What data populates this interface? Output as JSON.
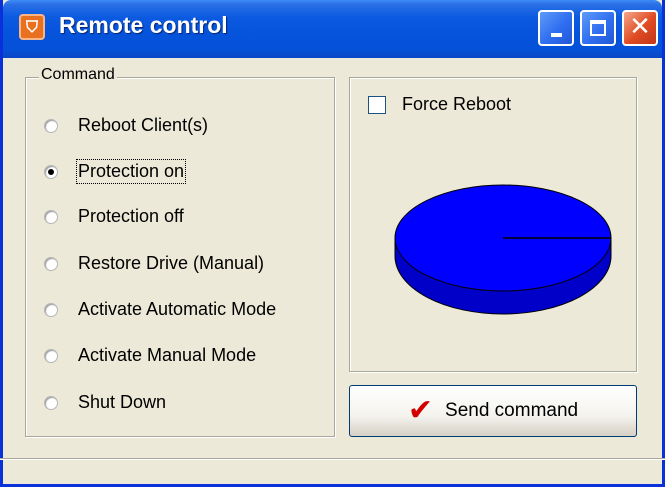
{
  "window": {
    "title": "Remote control",
    "app_icon": "shield-icon",
    "controls": {
      "minimize": "minimize-icon",
      "maximize": "maximize-icon",
      "close": "close-icon"
    }
  },
  "command_group": {
    "legend": "Command",
    "selected_index": 1,
    "options": [
      {
        "label": "Reboot Client(s)",
        "checked": false
      },
      {
        "label": "Protection on",
        "checked": true
      },
      {
        "label": "Protection off",
        "checked": false
      },
      {
        "label": "Restore Drive (Manual)",
        "checked": false
      },
      {
        "label": "Activate Automatic Mode",
        "checked": false
      },
      {
        "label": "Activate Manual Mode",
        "checked": false
      },
      {
        "label": "Shut Down",
        "checked": false
      }
    ]
  },
  "force_reboot": {
    "label": "Force Reboot",
    "checked": false
  },
  "progress_pie": {
    "color": "#0000ff",
    "shade_color": "#0000c8"
  },
  "send_button": {
    "label": "Send command",
    "icon": "checkmark-icon",
    "icon_color": "#d40000"
  }
}
